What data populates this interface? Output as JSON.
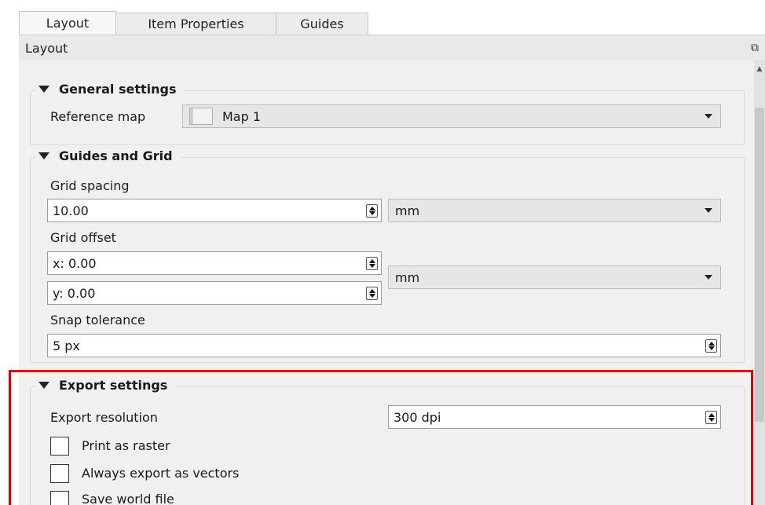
{
  "tabs": [
    "Layout",
    "Item Properties",
    "Guides"
  ],
  "dock": {
    "title": "Layout",
    "float_icon": "float-icon"
  },
  "general": {
    "title": "General settings",
    "reference_map_label": "Reference map",
    "reference_map_value": "Map 1"
  },
  "guides_grid": {
    "title": "Guides and Grid",
    "grid_spacing_label": "Grid spacing",
    "grid_spacing_value": "10.00",
    "grid_spacing_unit": "mm",
    "grid_offset_label": "Grid offset",
    "grid_offset_x": "x: 0.00",
    "grid_offset_y": "y: 0.00",
    "grid_offset_unit": "mm",
    "snap_tolerance_label": "Snap tolerance",
    "snap_tolerance_value": "5 px"
  },
  "export": {
    "title": "Export settings",
    "resolution_label": "Export resolution",
    "resolution_value": "300 dpi",
    "print_as_raster": "Print as raster",
    "always_vectors": "Always export as vectors",
    "save_world_file": "Save world file"
  },
  "colors": {
    "highlight": "#e00000"
  }
}
